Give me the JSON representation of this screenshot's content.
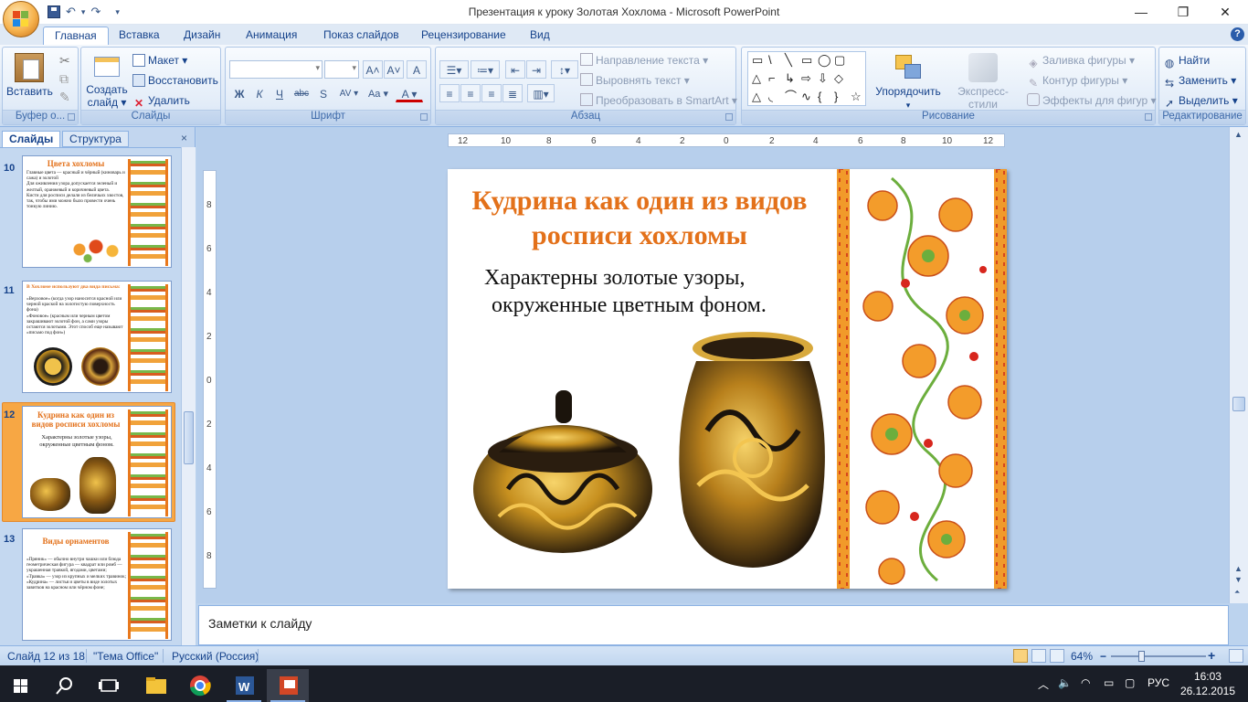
{
  "window": {
    "title": "Презентация к уроку Золотая Хохлома - Microsoft PowerPoint",
    "minimize": "—",
    "restore": "❐",
    "close": "✕"
  },
  "quick_access": {
    "undo": "↶",
    "redo": "↷",
    "more": "▾"
  },
  "ribbon_tabs": [
    "Главная",
    "Вставка",
    "Дизайн",
    "Анимация",
    "Показ слайдов",
    "Рецензирование",
    "Вид"
  ],
  "ribbon": {
    "clipboard": {
      "label": "Буфер о...",
      "paste": "Вставить",
      "cut_icon": "scissors-icon",
      "copy_icon": "copy-icon",
      "format_icon": "brush-icon"
    },
    "slides": {
      "label": "Слайды",
      "new_slide": "Создать",
      "new_slide2": "слайд ▾",
      "layout": "Макет ▾",
      "reset": "Восстановить",
      "delete": "Удалить"
    },
    "font": {
      "label": "Шрифт",
      "bold": "Ж",
      "italic": "К",
      "underline": "Ч",
      "strike": "abc",
      "shadow": "S",
      "spacing": "AV ▾",
      "case": "Aa ▾",
      "color": "A ▾",
      "grow": "A˄",
      "shrink": "A˅",
      "clear": "A"
    },
    "paragraph": {
      "label": "Абзац",
      "text_direction": "Направление текста ▾",
      "align_text": "Выровнять текст ▾",
      "smartart": "Преобразовать в SmartArt ▾"
    },
    "drawing": {
      "label": "Рисование",
      "arrange": "Упорядочить",
      "quick_styles": "Экспресс-стили",
      "fill": "Заливка фигуры ▾",
      "outline": "Контур фигуры ▾",
      "effects": "Эффекты для фигур ▾",
      "shapes": [
        "▭",
        "\\",
        "╲",
        "▭",
        "◯",
        "▢",
        "⬜",
        "╲",
        "⌐",
        "↳",
        "⇨",
        "⇩",
        "◇",
        "◟",
        "⌒",
        "∿",
        "{",
        "}",
        "☆"
      ]
    },
    "editing": {
      "label": "Редактирование",
      "find": "Найти",
      "replace": "Заменить ▾",
      "select": "Выделить ▾"
    }
  },
  "left_pane": {
    "tab_slides": "Слайды",
    "tab_outline": "Структура",
    "close": "×",
    "thumbnails": [
      {
        "num": "10",
        "title": "Цвета хохломы",
        "body": "Главные цвета — красный и чёрный (киноварь и сажа) и золотой\nДля оживления узора допускается зеленый и желтый, оранжевый и коричневый цвета.\nКисти для росписи делали из беличьих хвостов, так, чтобы ими можно было провести очень тонкую линию."
      },
      {
        "num": "11",
        "title": "В Хохломе используют два вида письма:",
        "body": "«Верховое» (когда узор наносится красной или черной краской на золотистую поверхность фона)\n«Фоновое» (красным или черным цветом закрашивают золотой фон, а сами узоры остаются золотыми. Этот способ еще называют «письмо под фон»)"
      },
      {
        "num": "12",
        "title": "Кудрина как один из видов росписи хохломы",
        "body": "Характерны золотые узоры, окруженные цветным фоном."
      },
      {
        "num": "13",
        "title": "Виды орнаментов",
        "body": "«Пряник» — обычно внутри чашки или блюда геометрическая фигура — квадрат или ромб — украшенная травкой, ягодами, цветами;\n«Травка» — узор из крупных и мелких травинок;\n«Кудрина» — листья и цветы в виде золотых завитков на красном или чёрном фоне;"
      }
    ]
  },
  "slide": {
    "title": "Кудрина как один из видов росписи хохломы",
    "body_line1": "Характерны золотые узоры,",
    "body_line2": "окруженные цветным фоном."
  },
  "ruler": {
    "h_ticks": [
      "12",
      "10",
      "8",
      "6",
      "4",
      "2",
      "0",
      "2",
      "4",
      "6",
      "8",
      "10",
      "12"
    ],
    "v_ticks": [
      "8",
      "6",
      "4",
      "2",
      "0",
      "2",
      "4",
      "6",
      "8"
    ]
  },
  "notes": {
    "placeholder": "Заметки к слайду"
  },
  "statusbar": {
    "slide_info": "Слайд 12 из 18",
    "theme": "\"Тема Office\"",
    "language": "Русский (Россия)",
    "zoom": "64%",
    "zoom_minus": "−",
    "zoom_plus": "+"
  },
  "taskbar": {
    "lang": "РУС",
    "time": "16:03",
    "date": "26.12.2015",
    "tray_icons": [
      "chevron-up-icon",
      "volume-icon",
      "wifi-icon",
      "battery-icon",
      "message-icon"
    ]
  },
  "colors": {
    "accent": "#e3711a",
    "ribbon": "#dce8f6",
    "taskbar": "#1a1e27"
  }
}
